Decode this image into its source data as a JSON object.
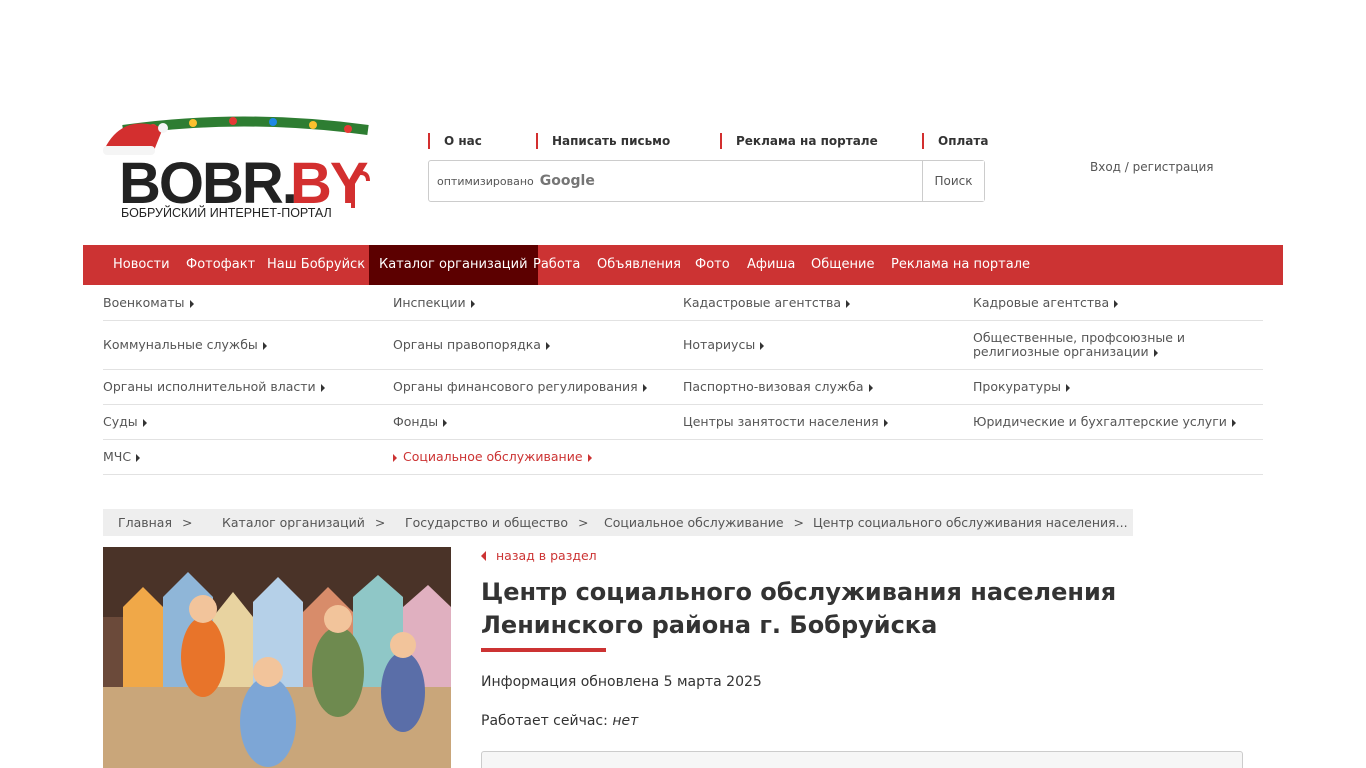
{
  "logo": {
    "text": "BOBR.BY",
    "subtitle": "БОБРУЙСКИЙ ИНТЕРНЕТ-ПОРТАЛ"
  },
  "toplinks": [
    "О нас",
    "Написать письмо",
    "Реклама на портале",
    "Оплата"
  ],
  "search": {
    "placeholder": "оптимизировано",
    "brand": "Google",
    "button": "Поиск"
  },
  "login": "Вход / регистрация",
  "nav": {
    "items": [
      "Новости",
      "Фотофакт",
      "Наш Бобруйск",
      "Каталог организаций",
      "Работа",
      "Объявления",
      "Фото",
      "Афиша",
      "Общение",
      "Реклама на портале"
    ],
    "active": "Каталог организаций"
  },
  "catalog": [
    [
      "Военкоматы",
      "Инспекции",
      "Кадастровые агентства",
      "Кадровые агентства"
    ],
    [
      "Коммунальные службы",
      "Органы правопорядка",
      "Нотариусы",
      "Общественные, профсоюзные и религиозные организации"
    ],
    [
      "Органы исполнительной власти",
      "Органы финансового регулирования",
      "Паспортно-визовая служба",
      "Прокуратуры"
    ],
    [
      "Суды",
      "Фонды",
      "Центры занятости населения",
      "Юридические и бухгалтерские услуги"
    ],
    [
      "МЧС",
      "Социальное обслуживание"
    ]
  ],
  "breadcrumb": [
    "Главная",
    "Каталог организаций",
    "Государство и общество",
    "Социальное обслуживание",
    "Центр социального обслуживания населения..."
  ],
  "breadcrumb_sep": ">",
  "content": {
    "back": "назад в раздел",
    "title": "Центр социального обслуживания населения Ленинского района г. Бобруйска",
    "updated": "Информация обновлена 5 марта 2025",
    "work_now_label": "Работает сейчас:",
    "work_now_value": "нет"
  },
  "colors": {
    "accent": "#cc3333",
    "nav_active": "#5c0000"
  }
}
